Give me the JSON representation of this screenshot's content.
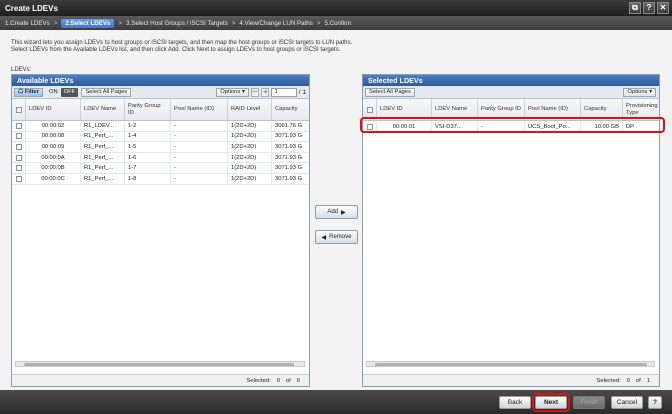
{
  "window": {
    "title": "Create LDEVs",
    "controls": [
      "⧉",
      "?",
      "✕"
    ]
  },
  "steps": [
    {
      "label": "1.Create LDEVs",
      "active": false
    },
    {
      "label": "2.Select LDEVs",
      "active": true
    },
    {
      "label": "3.Select Host Groups / iSCSI Targets",
      "active": false
    },
    {
      "label": "4.View/Change LUN Paths",
      "active": false
    },
    {
      "label": "5.Confirm",
      "active": false
    }
  ],
  "step_separator": ">",
  "description": {
    "line1": "This wizard lets you assign LDEVs to host groups or iSCSI targets, and then map the host groups or iSCSI targets to LUN paths.",
    "line2": "Select LDEVs from the Available LDEVs list, and then click Add. Click Next to assign LDEVs to host groups or iSCSI targets."
  },
  "ldevs_label": "LDEVs:",
  "available": {
    "title": "Available LDEVs",
    "filter_label": "Filter",
    "on_label": "ON",
    "off_label": "OFF",
    "select_all_label": "Select All Pages",
    "options_label": "Options",
    "page_current": "1",
    "page_total": "/ 1",
    "columns": [
      "LDEV ID",
      "LDEV Name",
      "Parity Group ID",
      "Pool Name (ID)",
      "RAID Level",
      "Capacity"
    ],
    "rows": [
      [
        "00:00:02",
        "R1_LDEV...",
        "1-2",
        "-",
        "1(2D+2D)",
        "3061.76 G"
      ],
      [
        "00:00:08",
        "R1_Perf_...",
        "1-4",
        "-",
        "1(2D+2D)",
        "3071.93 G"
      ],
      [
        "00:00:09",
        "R1_Perf_...",
        "1-5",
        "-",
        "1(2D+2D)",
        "3071.93 G"
      ],
      [
        "00:00:0A",
        "R1_Perf_...",
        "1-6",
        "-",
        "1(2D+2D)",
        "3071.93 G"
      ],
      [
        "00:00:0B",
        "R1_Perf_...",
        "1-7",
        "-",
        "1(2D+2D)",
        "3071.93 G"
      ],
      [
        "00:00:0C",
        "R1_Perf_...",
        "1-8",
        "-",
        "1(2D+2D)",
        "3071.93 G"
      ]
    ],
    "selected_label": "Selected:",
    "selected_count": "0",
    "of_label": "of",
    "total": "6"
  },
  "buttons": {
    "add": "Add",
    "remove": "Remove",
    "add_icon": "▶",
    "remove_icon": "◀"
  },
  "selected": {
    "title": "Selected LDEVs",
    "select_all_label": "Select All Pages",
    "options_label": "Options",
    "columns": [
      "LDEV ID",
      "LDEV Name",
      "Parity Group ID",
      "Pool Name (ID)",
      "Capacity",
      "Provisioning Type"
    ],
    "rows": [
      [
        "00:00:01",
        "VSI-D37...",
        "-",
        "UCS_Boot_Po...",
        "10.00 GB",
        "DP"
      ]
    ],
    "selected_label": "Selected:",
    "selected_count": "0",
    "of_label": "of",
    "total": "1"
  },
  "footer_buttons": {
    "back": "Back",
    "next": "Next",
    "finish": "Finish",
    "cancel": "Cancel",
    "help": "?"
  }
}
